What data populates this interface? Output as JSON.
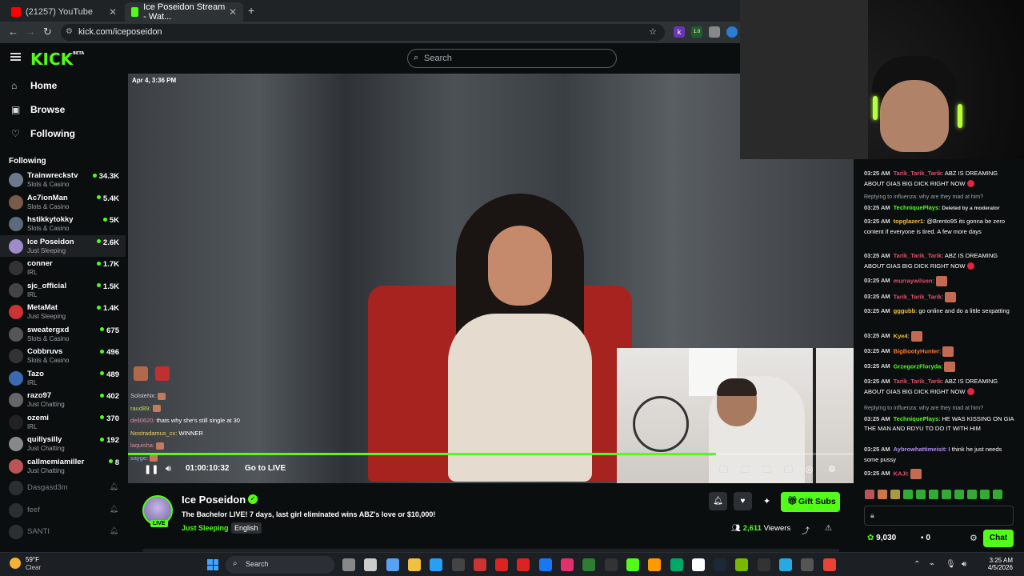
{
  "browser": {
    "tabs": [
      {
        "label": "(21257) YouTube",
        "favicon_color": "#ff0000"
      },
      {
        "label": "Ice Poseidon Stream - Wat...",
        "favicon_color": "#53fc18"
      }
    ],
    "url": "kick.com/iceposeidon"
  },
  "kick": {
    "logo": "KICK",
    "logo_badge": "BETA",
    "search_placeholder": "Search",
    "accent": "#53fc18"
  },
  "sidebar": {
    "nav": [
      {
        "label": "Home",
        "icon": "home-icon",
        "glyph": "⌂"
      },
      {
        "label": "Browse",
        "icon": "browse-icon",
        "glyph": "▣"
      },
      {
        "label": "Following",
        "icon": "heart-icon",
        "glyph": "♡"
      }
    ],
    "following_label": "Following",
    "channels": [
      {
        "name": "Trainwreckstv",
        "category": "Slots & Casino",
        "viewers": "34.3K",
        "color": "#6a7a8a"
      },
      {
        "name": "Ac7ionMan",
        "category": "Slots & Casino",
        "viewers": "5.4K",
        "color": "#7a5a4a"
      },
      {
        "name": "hstikkytokky",
        "category": "Slots & Casino",
        "viewers": "5K",
        "color": "#5b6b7b"
      },
      {
        "name": "Ice Poseidon",
        "category": "Just Sleeping",
        "viewers": "2.6K",
        "color": "#9d8cc9"
      },
      {
        "name": "conner",
        "category": "IRL",
        "viewers": "1.7K",
        "color": "#333"
      },
      {
        "name": "sjc_official",
        "category": "IRL",
        "viewers": "1.5K",
        "color": "#444"
      },
      {
        "name": "MetaMat",
        "category": "Just Sleeping",
        "viewers": "1.4K",
        "color": "#cc3333"
      },
      {
        "name": "sweatergxd",
        "category": "Slots & Casino",
        "viewers": "675",
        "color": "#555"
      },
      {
        "name": "Cobbruvs",
        "category": "Slots & Casino",
        "viewers": "496",
        "color": "#333"
      },
      {
        "name": "Tazo",
        "category": "IRL",
        "viewers": "489",
        "color": "#3a6ab0"
      },
      {
        "name": "razo97",
        "category": "Just Chatting",
        "viewers": "402",
        "color": "#666"
      },
      {
        "name": "ozemi",
        "category": "IRL",
        "viewers": "370",
        "color": "#222"
      },
      {
        "name": "quillysilly",
        "category": "Just Chatting",
        "viewers": "192",
        "color": "#888"
      },
      {
        "name": "callmemiamiller",
        "category": "Just Chatting",
        "viewers": "8",
        "color": "#b55"
      }
    ],
    "offline_channels": [
      "Dasgasd3m",
      "feef",
      "SANTI"
    ]
  },
  "video": {
    "date_tag": "Apr 4, 3:36 PM",
    "timecode": "01:00:10:32",
    "go_live": "Go to LIVE",
    "progress_fraction": 0.81,
    "overlay_chat": [
      {
        "user": "SolsteNx:",
        "text": "",
        "user_color": "#cfcfcf"
      },
      {
        "user": "raud89:",
        "text": "",
        "user_color": "#bada55"
      },
      {
        "user": "deli0620:",
        "text": "thats why she's still single at 30",
        "user_color": "#e08aa0"
      },
      {
        "user": "Nostradamus_cx:",
        "text": "WINNER",
        "user_color": "#f0d060"
      },
      {
        "user": "laquisha:",
        "text": "",
        "user_color": "#e08aa0"
      },
      {
        "user": "sayge:",
        "text": "",
        "user_color": "#9ad"
      }
    ]
  },
  "stream_info": {
    "streamer": "Ice Poseidon",
    "live_label": "LIVE",
    "title": "The Bachelor LIVE! 7 days, last girl eliminated wins ABZ's love or $10,000!",
    "category": "Just Sleeping",
    "language": "English",
    "gift_label": "Gift Subs",
    "viewer_count": "2,611",
    "viewers_label": "Viewers"
  },
  "chat": {
    "messages": [
      {
        "time": "03:25 AM",
        "user": "Tarik_Tarik_Tarik",
        "user_color": "#e0506a",
        "text": "ABZ IS DREAMING ABOUT GIAS BIG DICK RIGHT NOW",
        "heart": true
      },
      {
        "reply": "Replying to influenza: why are they mad at him?",
        "time": "03:25 AM",
        "user": "TechniquePlays",
        "user_color": "#53fc18",
        "text": "Deleted by a moderator"
      },
      {
        "time": "03:25 AM",
        "user": "topglazer1",
        "user_color": "#f0c040",
        "text": "@Brento95 its gonna be zero content if everyone is tired. A few more days"
      },
      {
        "time": "03:25 AM",
        "user": "Tarik_Tarik_Tarik",
        "user_color": "#e0506a",
        "text": "ABZ IS DREAMING ABOUT GIAS BIG DICK RIGHT NOW",
        "heart": true
      },
      {
        "time": "03:25 AM",
        "user": "murraywilson",
        "user_color": "#e0506a",
        "text": "",
        "emote": true
      },
      {
        "time": "03:25 AM",
        "user": "Tarik_Tarik_Tarik",
        "user_color": "#e0506a",
        "text": "",
        "emote": true
      },
      {
        "time": "03:25 AM",
        "user": "gggubb",
        "user_color": "#f0c040",
        "text": "go online and do a little sexpatting"
      },
      {
        "time": "03:25 AM",
        "user": "Kye4",
        "user_color": "#f0c040",
        "text": "",
        "emote": true
      },
      {
        "time": "03:25 AM",
        "user": "BigBootyHunter",
        "user_color": "#ff7733",
        "text": "",
        "emote": true
      },
      {
        "time": "03:25 AM",
        "user": "GrzegorzFloryda",
        "user_color": "#53fc18",
        "text": "",
        "emote": true
      },
      {
        "time": "03:25 AM",
        "user": "Tarik_Tarik_Tarik",
        "user_color": "#e0506a",
        "text": "ABZ IS DREAMING ABOUT GIAS BIG DICK RIGHT NOW",
        "heart": true
      },
      {
        "reply": "Replying to influenza: why are they mad at him?",
        "time": "03:25 AM",
        "user": "TechniquePlays",
        "user_color": "#53fc18",
        "text": "HE WAS KISSING ON GIA THE MAN AND RDYU TO DO IT WITH HIM"
      },
      {
        "time": "03:25 AM",
        "user": "Aybrowhattimeisit",
        "user_color": "#b08cf0",
        "text": "I think he just needs some pussy"
      },
      {
        "time": "03:25 AM",
        "user": "KAJI",
        "user_color": "#e0506a",
        "text": "",
        "emote": true
      }
    ],
    "points": "9,030",
    "points2": "0",
    "send_label": "Chat"
  },
  "taskbar": {
    "temp": "59°F",
    "condition": "Clear",
    "search": "Search",
    "time": "3:25 AM",
    "date": "4/5/2026"
  }
}
